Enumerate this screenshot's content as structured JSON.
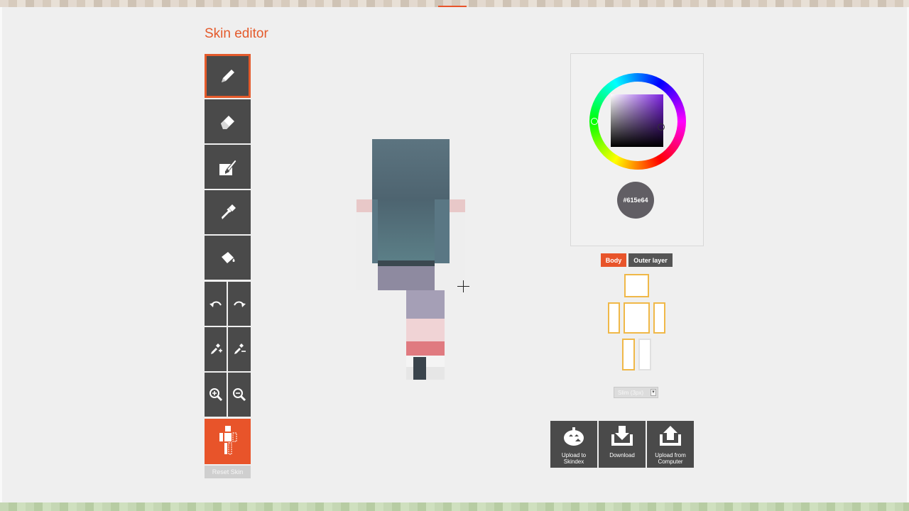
{
  "title": "Skin editor",
  "toolbar": {
    "tools": [
      {
        "name": "pencil",
        "icon": "pencil-icon",
        "active": true
      },
      {
        "name": "eraser",
        "icon": "eraser-icon"
      },
      {
        "name": "brush",
        "icon": "brush-icon"
      },
      {
        "name": "eyedropper",
        "icon": "eyedropper-icon"
      },
      {
        "name": "bucket",
        "icon": "bucket-icon"
      }
    ],
    "undo_icon": "undo-icon",
    "redo_icon": "redo-icon",
    "lighten_icon": "lighten-icon",
    "darken_icon": "darken-icon",
    "zoom_in_icon": "zoom-in-icon",
    "zoom_out_icon": "zoom-out-icon",
    "body_toggle_icon": "body-parts-icon",
    "reset_label": "Reset Skin"
  },
  "color_picker": {
    "hex": "#615e64",
    "current_color": "#615e64"
  },
  "layer_tabs": {
    "body": "Body",
    "outer": "Outer layer",
    "active": "Body"
  },
  "body_parts": [
    "head",
    "left-arm",
    "torso",
    "right-arm",
    "left-leg",
    "right-leg"
  ],
  "model_select": {
    "value": "Slim (3px)"
  },
  "actions": {
    "upload_skindex_line1": "Upload to",
    "upload_skindex_line2": "Skindex",
    "download": "Download",
    "upload_computer_line1": "Upload from",
    "upload_computer_line2": "Computer"
  },
  "colors": {
    "accent": "#e45a2b",
    "tool_bg": "#4a4a4a",
    "part_outline": "#f0b848"
  }
}
